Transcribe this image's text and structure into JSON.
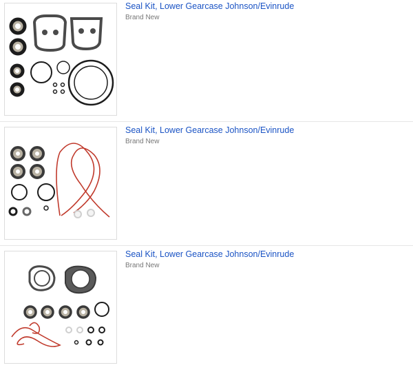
{
  "listings": [
    {
      "title": "Seal Kit, Lower Gearcase Johnson/Evinrude",
      "condition": "Brand New"
    },
    {
      "title": "Seal Kit, Lower Gearcase Johnson/Evinrude",
      "condition": "Brand New"
    },
    {
      "title": "Seal Kit, Lower Gearcase Johnson/Evinrude",
      "condition": "Brand New"
    }
  ],
  "colors": {
    "link": "#1a53c4",
    "muted": "#777777",
    "gasket": "#4a4a4a",
    "seal_metal": "#b9b2a3",
    "rubber": "#1c1c1c",
    "red_cord": "#c0392b"
  }
}
